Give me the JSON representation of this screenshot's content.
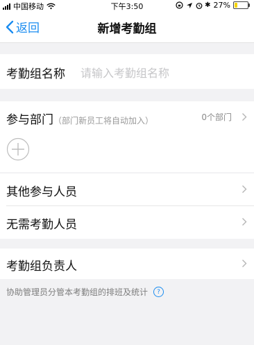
{
  "status_bar": {
    "carrier": "中国移动",
    "time": "下午3:50",
    "battery": "27%",
    "battery_level": 0.27
  },
  "nav": {
    "back_label": "返回",
    "title": "新增考勤组"
  },
  "group_name": {
    "label": "考勤组名称",
    "placeholder": "请输入考勤组名称"
  },
  "departments": {
    "label": "参与部门",
    "hint": "（部门新员工将自动加入）",
    "count": "0个部门"
  },
  "other_participants": {
    "label": "其他参与人员"
  },
  "no_attendance": {
    "label": "无需考勤人员"
  },
  "owner": {
    "label": "考勤组负责人",
    "footnote": "协助管理员分管本考勤组的排班及统计",
    "help_icon": "?"
  },
  "colors": {
    "accent": "#1a8cf0",
    "background": "#f2f2f4",
    "battery": "#f5d400"
  }
}
